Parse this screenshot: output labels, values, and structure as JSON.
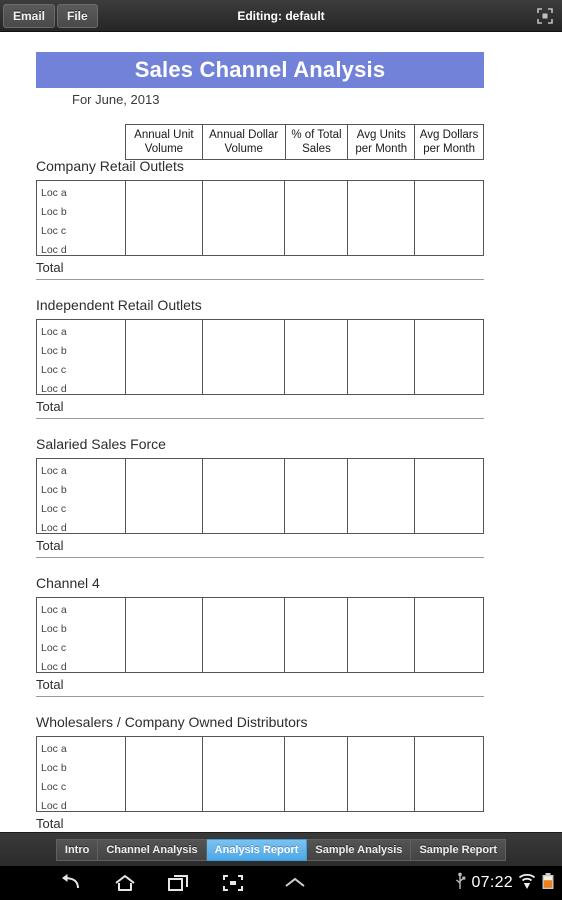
{
  "appbar": {
    "buttons": [
      {
        "label": "Email",
        "name": "email-button"
      },
      {
        "label": "File",
        "name": "file-button"
      }
    ],
    "title": "Editing: default",
    "right_icon": "fullscreen-icon"
  },
  "document": {
    "banner_title": "Sales Channel Analysis",
    "subtitle": "For June, 2013",
    "column_headers": [
      "Annual Unit Volume",
      "Annual Dollar Volume",
      "% of Total Sales",
      "Avg Units per Month",
      "Avg Dollars per Month"
    ],
    "row_labels": [
      "Loc a",
      "Loc b",
      "Loc c",
      "Loc d"
    ],
    "total_label": "Total",
    "sections": [
      {
        "title": "Company Retail Outlets"
      },
      {
        "title": "Independent Retail Outlets"
      },
      {
        "title": "Salaried Sales Force"
      },
      {
        "title": "Channel 4"
      },
      {
        "title": "Wholesalers / Company Owned Distributors"
      }
    ]
  },
  "tabs": [
    {
      "label": "Intro",
      "active": false
    },
    {
      "label": "Channel Analysis",
      "active": false
    },
    {
      "label": "Analysis Report",
      "active": true
    },
    {
      "label": "Sample Analysis",
      "active": false
    },
    {
      "label": "Sample Report",
      "active": false
    }
  ],
  "navbar": {
    "back_icon": "back-arrow-icon",
    "home_icon": "home-icon",
    "recents_icon": "recent-apps-icon",
    "screenshot_icon": "screenshot-icon",
    "chevron_icon": "chevron-up-icon",
    "usb_icon": "usb-icon",
    "clock": "07:22",
    "wifi_icon": "wifi-icon",
    "battery_icon": "battery-icon"
  },
  "colors": {
    "banner": "#7282d8",
    "active_tab": "#4aa8e8",
    "appbar": "#323232"
  }
}
